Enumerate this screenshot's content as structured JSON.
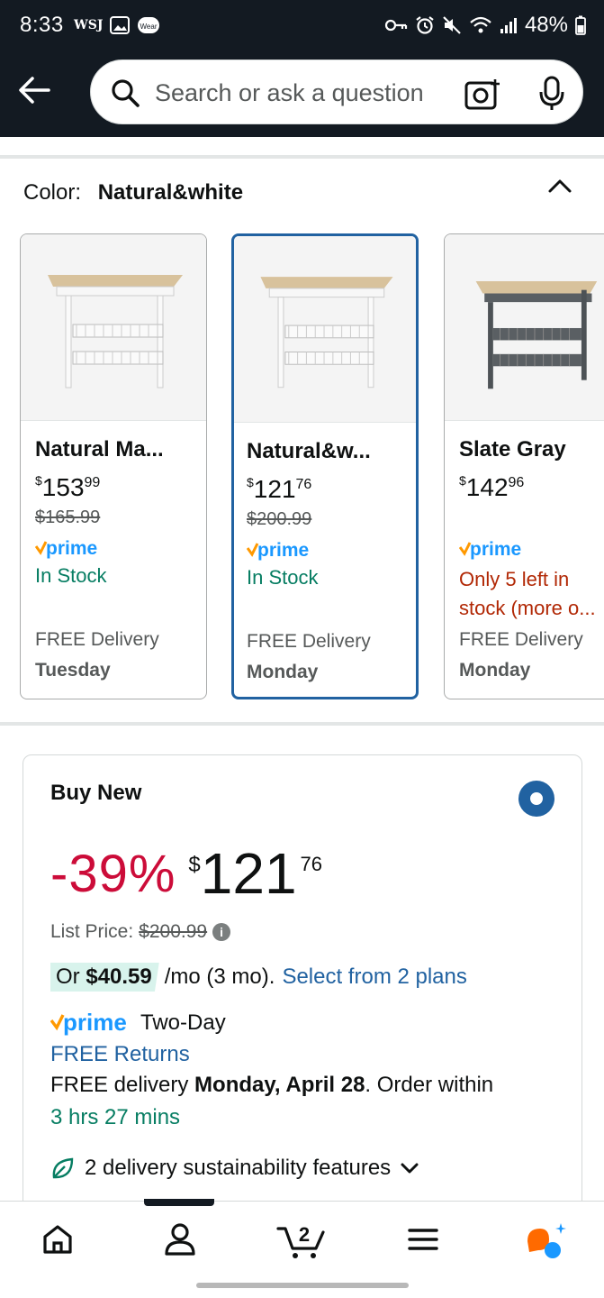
{
  "status_bar": {
    "time": "8:33",
    "wsj": "WSJ",
    "wear": "Wear",
    "battery": "48%"
  },
  "header": {
    "search_placeholder": "Search or ask a question"
  },
  "color_selector": {
    "label": "Color:",
    "selected": "Natural&white"
  },
  "variants": [
    {
      "title": "Natural Ma...",
      "price_symbol": "$",
      "price_whole": "153",
      "price_cents": "99",
      "list_price": "$165.99",
      "prime": "prime",
      "stock": "In Stock",
      "delivery": "FREE Delivery",
      "day": "Tuesday",
      "frame_color": "#ffffff"
    },
    {
      "title": "Natural&w...",
      "price_symbol": "$",
      "price_whole": "121",
      "price_cents": "76",
      "list_price": "$200.99",
      "prime": "prime",
      "stock": "In Stock",
      "delivery": "FREE Delivery",
      "day": "Monday",
      "frame_color": "#ffffff",
      "selected": true
    },
    {
      "title": "Slate Gray",
      "price_symbol": "$",
      "price_whole": "142",
      "price_cents": "96",
      "list_price": "",
      "prime": "prime",
      "stock_line1": "Only 5 left in",
      "stock_line2": "stock (more o...",
      "delivery": "FREE Delivery",
      "day": "Monday",
      "frame_color": "#5a5f63"
    }
  ],
  "buy_box": {
    "title": "Buy New",
    "discount": "-39%",
    "price_symbol": "$",
    "price_whole": "121",
    "price_cents": "76",
    "list_price_label": "List Price:",
    "list_price": "$200.99",
    "installment_or": "Or",
    "installment_amount": "$40.59",
    "installment_terms": "/mo (3 mo).",
    "installment_link": "Select from 2 plans",
    "prime": "prime",
    "prime_speed": "Two-Day",
    "free_returns": "FREE Returns",
    "free_delivery_prefix": "FREE delivery",
    "delivery_date": "Monday, April 28",
    "order_within_text": ". Order within",
    "countdown": "3 hrs 27 mins",
    "sustainability": "2 delivery sustainability features"
  },
  "bottom_nav": {
    "cart_count": "2"
  },
  "colors": {
    "header_bg": "#131a22",
    "link_blue": "#2162a1",
    "deal_red": "#cc0c39",
    "stock_green": "#067d62",
    "stock_red": "#b12704",
    "prime_blue": "#1a98ff",
    "prime_check": "#ff9900"
  }
}
